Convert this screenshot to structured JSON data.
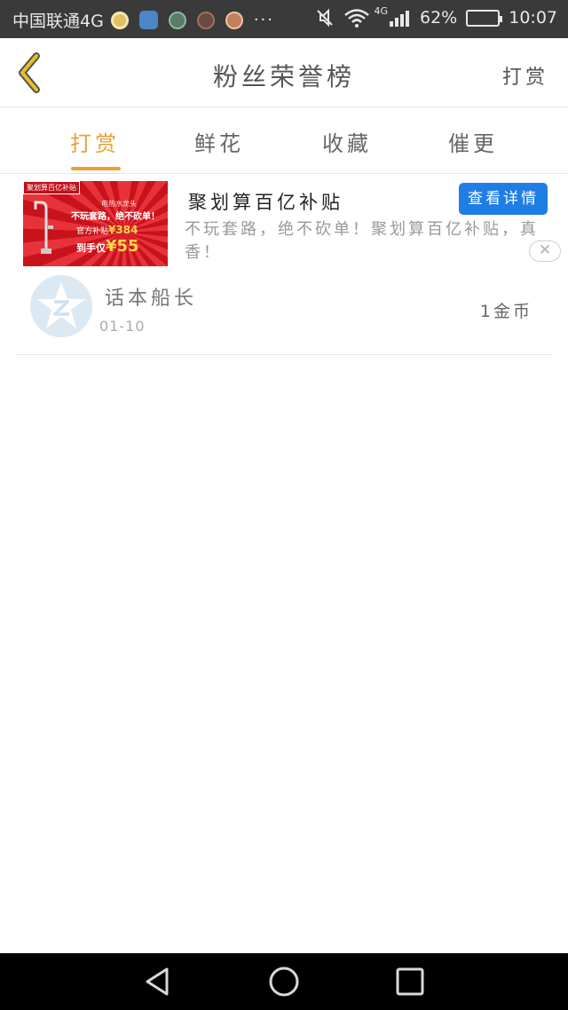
{
  "status_bar": {
    "carrier": "中国联通4G",
    "more": "···",
    "network": "4G",
    "battery": "62%",
    "battery_level": 0.62,
    "time": "10:07",
    "notification_icons": [
      "mango-app-icon",
      "maps-app-icon",
      "shield-app-icon",
      "game-app-icon",
      "chat-app-icon"
    ]
  },
  "header": {
    "title": "粉丝荣誉榜",
    "action": "打赏",
    "back_icon": "chevron-left-icon",
    "accent": "#e0b000"
  },
  "tabs": [
    {
      "label": "打赏",
      "active": true
    },
    {
      "label": "鲜花",
      "active": false
    },
    {
      "label": "收藏",
      "active": false
    },
    {
      "label": "催更",
      "active": false
    }
  ],
  "ad": {
    "title": "聚划算百亿补贴",
    "button": "查看详情",
    "description": "不玩套路，绝不砍单！聚划算百亿补贴，真香！",
    "close": "✕",
    "image": {
      "tag": "聚划算百亿补贴",
      "subtitle": "电热水龙头",
      "headline": "不玩套路，绝不砍单！",
      "official_label": "官方补贴",
      "official_price": "¥384",
      "final_label": "到手仅",
      "final_price": "¥55"
    }
  },
  "list": [
    {
      "name": "话本船长",
      "date": "01-10",
      "amount": "1金币"
    }
  ],
  "colors": {
    "tab_active": "#e8a13a",
    "button": "#1e7ee6",
    "status_bar": "#3a3a3a"
  }
}
